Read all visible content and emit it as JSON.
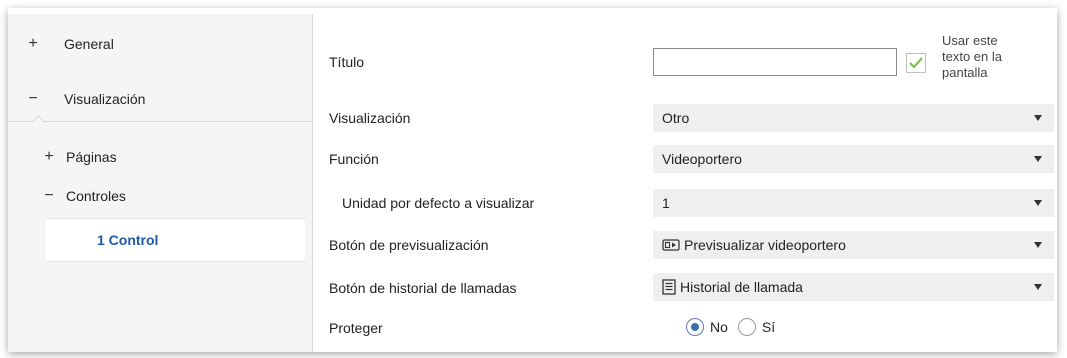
{
  "sidebar": {
    "items": [
      {
        "sign": "+",
        "label": "General"
      },
      {
        "sign": "−",
        "label": "Visualización"
      },
      {
        "sign": "+",
        "label": "Páginas"
      },
      {
        "sign": "−",
        "label": "Controles"
      }
    ],
    "selected": "1 Control"
  },
  "form": {
    "titulo": {
      "label": "Título",
      "value": "",
      "checkbox_checked": true,
      "checkbox_label": "Usar este\ntexto en la\npantalla"
    },
    "visualizacion": {
      "label": "Visualización",
      "value": "Otro"
    },
    "funcion": {
      "label": "Función",
      "value": "Videoportero"
    },
    "unidad": {
      "label": "Unidad por defecto a visualizar",
      "value": "1"
    },
    "previsualizacion": {
      "label": "Botón de previsualización",
      "value": "Previsualizar videoportero",
      "icon": "video-preview-icon"
    },
    "historial": {
      "label": "Botón de historial de llamadas",
      "value": "Historial de llamada",
      "icon": "document-list-icon"
    },
    "proteger": {
      "label": "Proteger",
      "options": [
        "No",
        "Sí"
      ],
      "selected": "No"
    }
  },
  "colors": {
    "accent": "#1e5aa8",
    "check": "#6cbf3a",
    "radio": "#3f6db0"
  }
}
